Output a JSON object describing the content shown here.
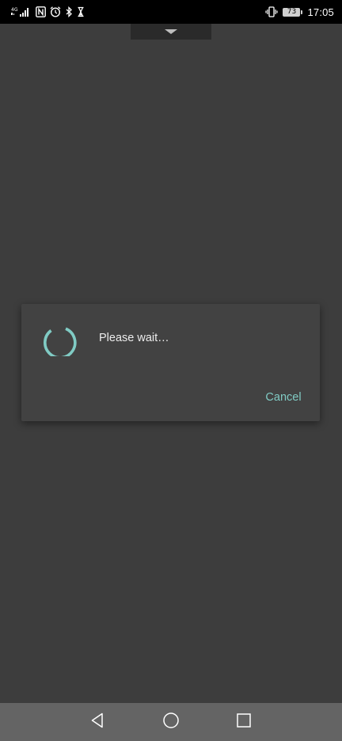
{
  "status_bar": {
    "network_type": "4G",
    "battery_level": "73",
    "time": "17:05"
  },
  "dialog": {
    "message": "Please wait…",
    "cancel_label": "Cancel"
  },
  "colors": {
    "accent": "#80cbc4",
    "background": "#3d3d3d",
    "dialog": "#424242",
    "nav_bar": "#646464"
  },
  "icons": {
    "status_left": [
      "signal-icon",
      "nfc-icon",
      "alarm-icon",
      "bluetooth-icon",
      "hourglass-icon"
    ],
    "status_right": [
      "vibrate-icon",
      "battery-icon"
    ],
    "nav": [
      "back-icon",
      "home-icon",
      "recents-icon"
    ]
  }
}
